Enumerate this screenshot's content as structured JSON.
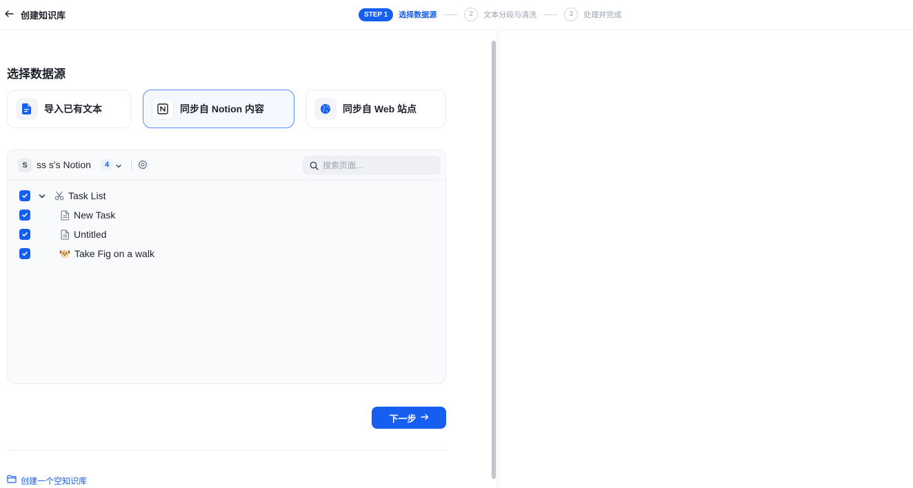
{
  "header": {
    "back_icon": "arrow-left-icon",
    "title": "创建知识库"
  },
  "steps": {
    "step1_pill": "STEP 1",
    "step1_label": "选择数据源",
    "step2_num": "2",
    "step2_label": "文本分段与清洗",
    "step3_num": "3",
    "step3_label": "处理并完成",
    "active_color": "#155eef"
  },
  "main": {
    "section_title": "选择数据源",
    "sources": [
      {
        "label": "导入已有文本",
        "icon": "document-icon",
        "active": false
      },
      {
        "label": "同步自 Notion 内容",
        "icon": "notion-icon",
        "active": true
      },
      {
        "label": "同步自 Web 站点",
        "icon": "globe-icon",
        "active": false
      }
    ]
  },
  "notion": {
    "workspace_initial": "S",
    "workspace_name": "ss s's Notion",
    "selected_count": "4",
    "search_placeholder": "搜索页面...",
    "pages": [
      {
        "label": "Task List",
        "icon": "scissors-icon",
        "checked": true,
        "expandable": true
      },
      {
        "label": "New Task",
        "icon": "page-icon",
        "checked": true,
        "expandable": false
      },
      {
        "label": "Untitled",
        "icon": "page-icon",
        "checked": true,
        "expandable": false
      },
      {
        "label": "Take Fig on a walk",
        "icon": "dog-icon",
        "emoji": "🐶",
        "checked": true,
        "expandable": false
      }
    ]
  },
  "footer": {
    "next_label": "下一步",
    "next_icon": "arrow-right-icon",
    "empty_kb_label": "创建一个空知识库",
    "empty_kb_icon": "folder-icon"
  }
}
